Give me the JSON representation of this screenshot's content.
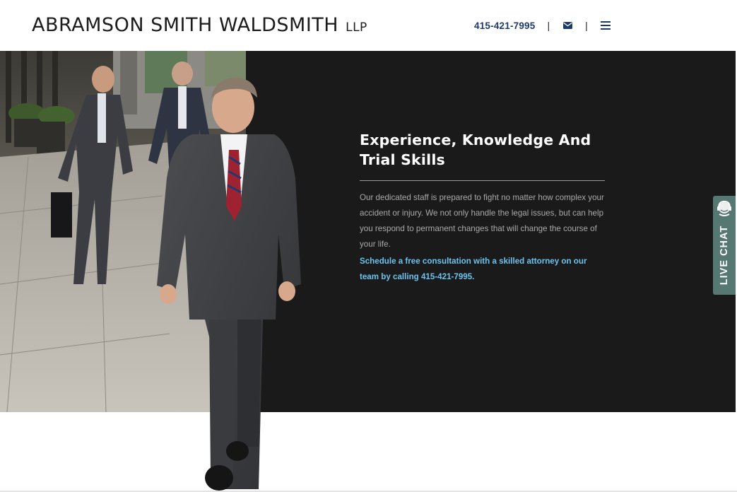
{
  "header": {
    "logo_main": "ABRAMSON SMITH WALDSMITH",
    "logo_suffix": "LLP",
    "phone": "415-421-7995",
    "separator": "|",
    "email_icon": "envelope-icon",
    "menu_icon": "hamburger-menu-icon"
  },
  "hero": {
    "title_line1": "Experience, Knowledge And",
    "title_line2": "Trial Skills",
    "body": "Our dedicated staff is prepared to fight no matter how complex your accident or injury. We not only handle the legal issues, but can help you respond to permanent changes that will change the course of your life.",
    "cta": "Schedule a free consultation with a skilled attorney on our team by calling 415-421-7995.",
    "image_icon": "attorneys-walking-photo"
  },
  "live_chat": {
    "label": "LIVE CHAT",
    "icon": "chat-agent-icon"
  },
  "colors": {
    "brand_navy": "#1d3a6e",
    "hero_dark": "#1a1a1b",
    "cta_blue": "#6cc3ee",
    "live_chat_teal": "#557873"
  }
}
